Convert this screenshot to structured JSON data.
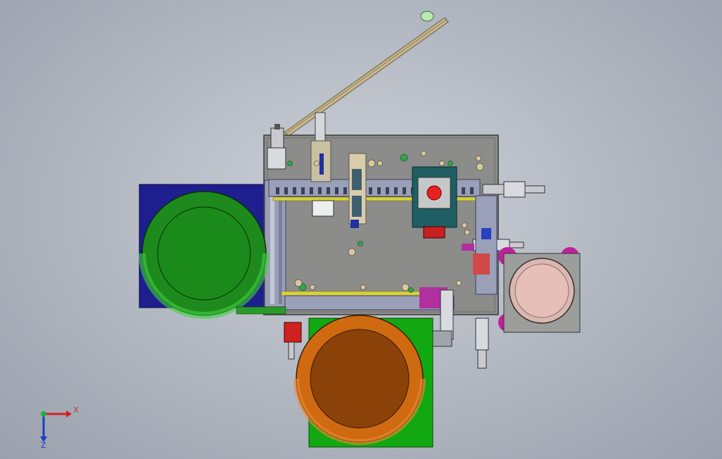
{
  "viewport": {
    "background": "#b6bcc6"
  },
  "triad": {
    "x_label": "X",
    "z_label": "Z",
    "colors": {
      "x": "#d42020",
      "y": "#20b040",
      "z": "#1f3fbf"
    }
  },
  "colors": {
    "plate": "#8c8d8a",
    "blue_base": "#1d1f8e",
    "green_bowl": "#1e8a1e",
    "orange_bowl": "#d06a10",
    "green_base": "#12a812",
    "pink_bowl": "#e6c0b8",
    "magenta_feet": "#c0209a",
    "teal_block": "#1f5e62",
    "yellow_rail": "#d7d236"
  }
}
